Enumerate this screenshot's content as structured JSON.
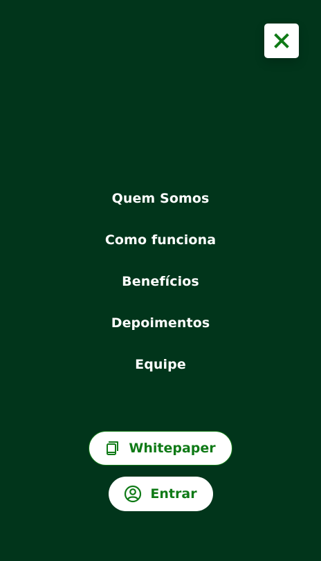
{
  "menu": {
    "items": [
      {
        "label": "Quem Somos"
      },
      {
        "label": "Como funciona"
      },
      {
        "label": "Benefícios"
      },
      {
        "label": "Depoimentos"
      },
      {
        "label": "Equipe"
      }
    ]
  },
  "actions": {
    "whitepaper": {
      "label": "Whitepaper",
      "icon": "document-icon"
    },
    "login": {
      "label": "Entrar",
      "icon": "user-circle-icon"
    }
  },
  "close_button": {
    "icon": "close-icon"
  },
  "colors": {
    "background": "#01351b",
    "accent": "#0f7a16",
    "button_bg": "#ffffff",
    "nav_text": "#ffffff"
  }
}
